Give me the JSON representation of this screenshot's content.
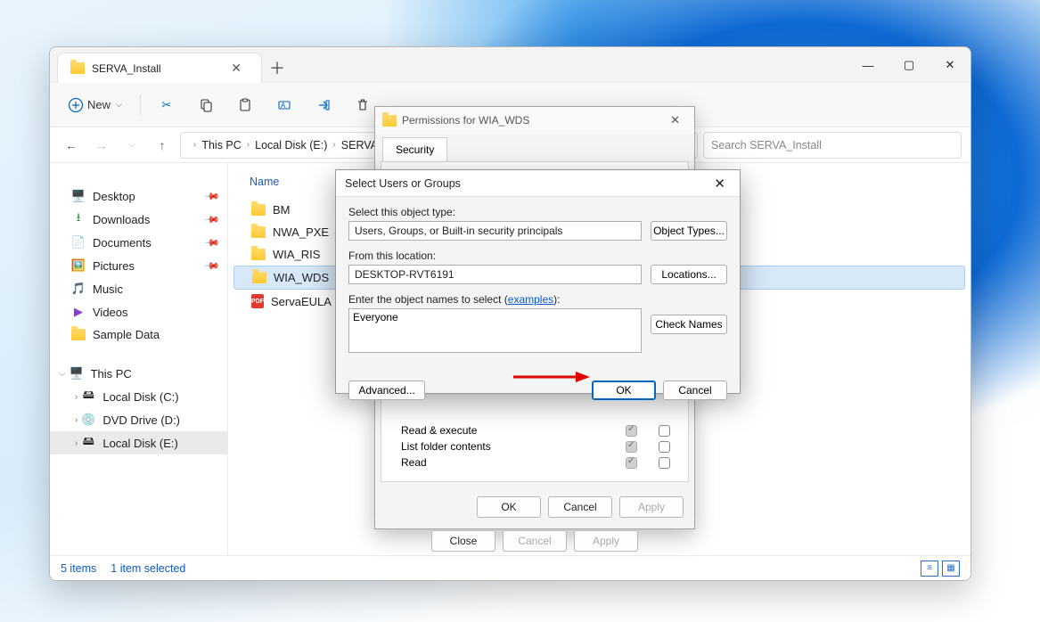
{
  "explorer": {
    "tab_title": "SERVA_Install",
    "toolbar": {
      "new": "New"
    },
    "breadcrumb": {
      "items": [
        "This PC",
        "Local Disk (E:)",
        "SERVA"
      ]
    },
    "search_placeholder": "Search SERVA_Install",
    "sidebar": {
      "quick": [
        {
          "label": "Desktop",
          "icon": "🖥️",
          "color": "#1e90d6"
        },
        {
          "label": "Downloads",
          "icon": "⬇",
          "color": "#2a8a3a"
        },
        {
          "label": "Documents",
          "icon": "📄",
          "color": "#4a7bd0"
        },
        {
          "label": "Pictures",
          "icon": "🖼️",
          "color": "#3aa0d8"
        },
        {
          "label": "Music",
          "icon": "🎵",
          "color": "#d0483a"
        },
        {
          "label": "Videos",
          "icon": "▶",
          "color": "#8a3ad8"
        },
        {
          "label": "Sample Data",
          "icon": "📁",
          "color": "#e6b93a"
        }
      ],
      "this_pc": "This PC",
      "drives": [
        {
          "label": "Local Disk (C:)"
        },
        {
          "label": "DVD Drive (D:)"
        },
        {
          "label": "Local Disk (E:)",
          "selected": true
        }
      ]
    },
    "columns": {
      "name": "Name"
    },
    "files": [
      {
        "name": "BM",
        "type": "folder"
      },
      {
        "name": "NWA_PXE",
        "type": "folder"
      },
      {
        "name": "WIA_RIS",
        "type": "folder"
      },
      {
        "name": "WIA_WDS",
        "type": "folder",
        "selected": true
      },
      {
        "name": "ServaEULA",
        "type": "pdf"
      }
    ],
    "status": {
      "count": "5 items",
      "selected": "1 item selected"
    }
  },
  "perm_dialog": {
    "title": "Permissions for WIA_WDS",
    "tab": "Security",
    "rows": [
      {
        "label": "Read & execute",
        "allow": true,
        "deny": false
      },
      {
        "label": "List folder contents",
        "allow": true,
        "deny": false
      },
      {
        "label": "Read",
        "allow": true,
        "deny": false
      }
    ],
    "buttons": {
      "ok": "OK",
      "cancel": "Cancel",
      "apply": "Apply",
      "close": "Close"
    }
  },
  "sel_dialog": {
    "title": "Select Users or Groups",
    "object_type_label": "Select this object type:",
    "object_type_value": "Users, Groups, or Built-in security principals",
    "object_types_btn": "Object Types...",
    "location_label": "From this location:",
    "location_value": "DESKTOP-RVT6191",
    "locations_btn": "Locations...",
    "names_label_prefix": "Enter the object names to select (",
    "examples": "examples",
    "names_label_suffix": "):",
    "names_value": "Everyone",
    "check_names_btn": "Check Names",
    "advanced_btn": "Advanced...",
    "ok": "OK",
    "cancel": "Cancel"
  }
}
